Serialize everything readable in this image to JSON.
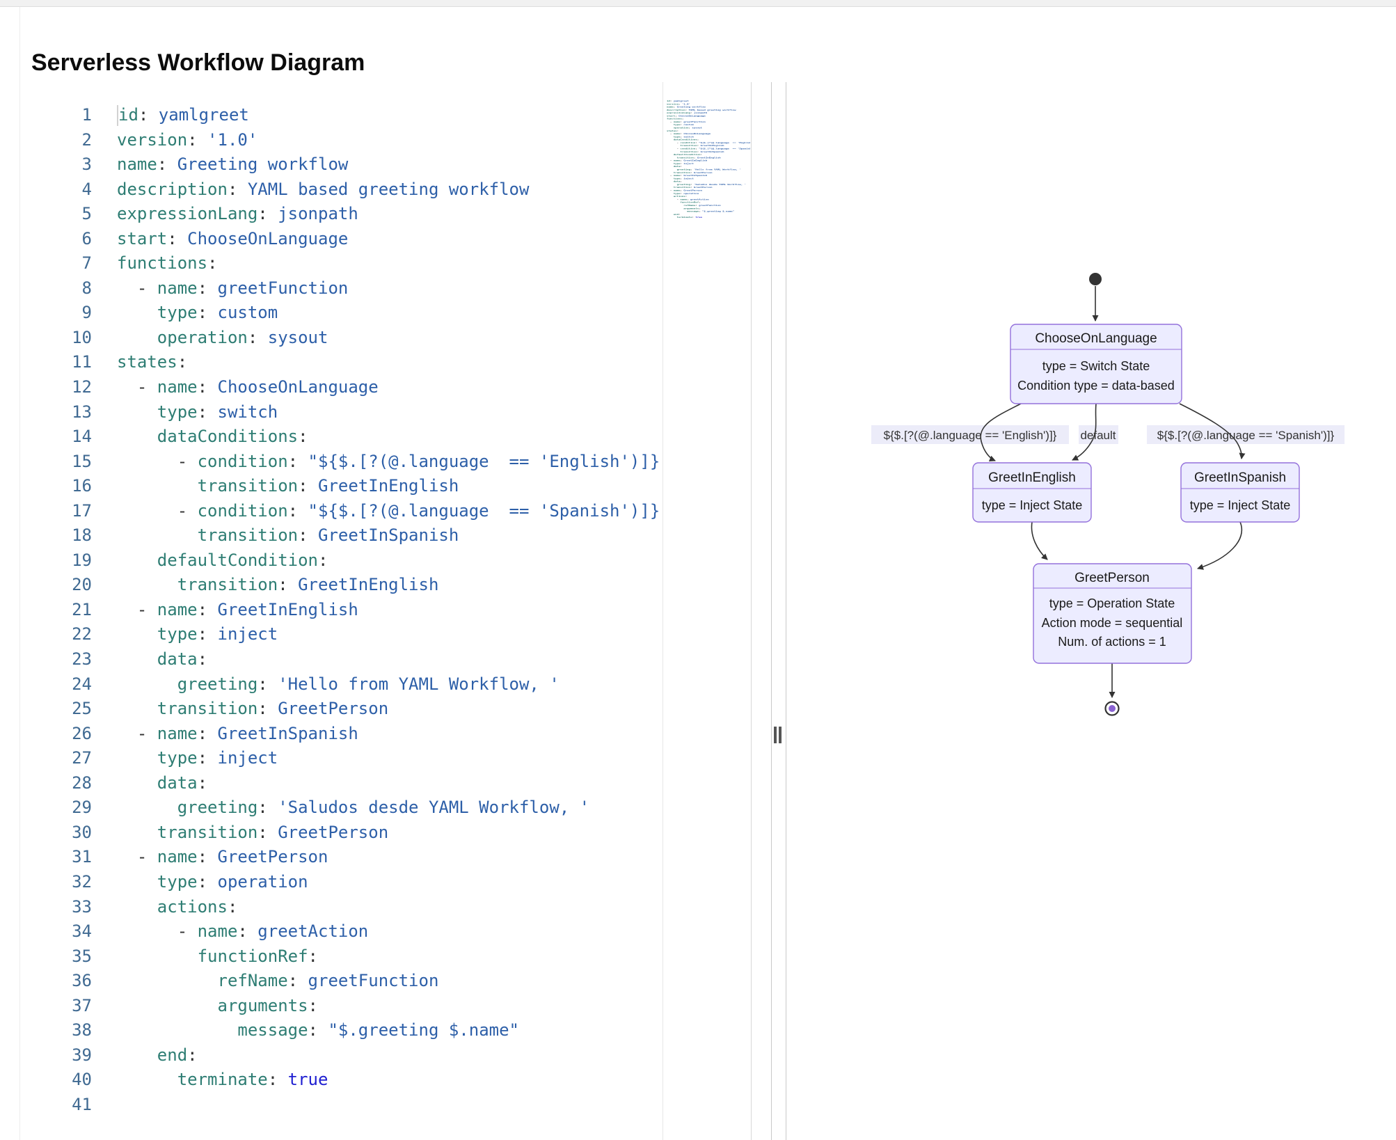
{
  "page": {
    "title": "Serverless Workflow Diagram"
  },
  "editor": {
    "colors": {
      "key": "#2e7d73",
      "value": "#2d5fa8",
      "punctuation": "#333333",
      "boolean": "#1f1fd1",
      "line_number": "#406a92"
    },
    "lines": [
      {
        "n": 1,
        "g": 0,
        "active": true,
        "t": [
          [
            "k",
            "id"
          ],
          [
            "p",
            ":"
          ],
          [
            "v",
            " yamlgreet"
          ]
        ]
      },
      {
        "n": 2,
        "g": 0,
        "t": [
          [
            "k",
            "version"
          ],
          [
            "p",
            ":"
          ],
          [
            "v",
            " '1.0'"
          ]
        ]
      },
      {
        "n": 3,
        "g": 0,
        "t": [
          [
            "k",
            "name"
          ],
          [
            "p",
            ":"
          ],
          [
            "v",
            " Greeting workflow"
          ]
        ]
      },
      {
        "n": 4,
        "g": 0,
        "t": [
          [
            "k",
            "description"
          ],
          [
            "p",
            ":"
          ],
          [
            "v",
            " YAML based greeting workflow"
          ]
        ]
      },
      {
        "n": 5,
        "g": 0,
        "t": [
          [
            "k",
            "expressionLang"
          ],
          [
            "p",
            ":"
          ],
          [
            "v",
            " jsonpath"
          ]
        ]
      },
      {
        "n": 6,
        "g": 0,
        "t": [
          [
            "k",
            "start"
          ],
          [
            "p",
            ":"
          ],
          [
            "v",
            " ChooseOnLanguage"
          ]
        ]
      },
      {
        "n": 7,
        "g": 0,
        "t": [
          [
            "k",
            "functions"
          ],
          [
            "p",
            ":"
          ]
        ]
      },
      {
        "n": 8,
        "g": 1,
        "t": [
          [
            "p",
            "  - "
          ],
          [
            "k",
            "name"
          ],
          [
            "p",
            ":"
          ],
          [
            "v",
            " greetFunction"
          ]
        ]
      },
      {
        "n": 9,
        "g": 2,
        "t": [
          [
            "p",
            "    "
          ],
          [
            "k",
            "type"
          ],
          [
            "p",
            ":"
          ],
          [
            "v",
            " custom"
          ]
        ]
      },
      {
        "n": 10,
        "g": 2,
        "t": [
          [
            "p",
            "    "
          ],
          [
            "k",
            "operation"
          ],
          [
            "p",
            ":"
          ],
          [
            "v",
            " sysout"
          ]
        ]
      },
      {
        "n": 11,
        "g": 0,
        "t": [
          [
            "k",
            "states"
          ],
          [
            "p",
            ":"
          ]
        ]
      },
      {
        "n": 12,
        "g": 1,
        "t": [
          [
            "p",
            "  - "
          ],
          [
            "k",
            "name"
          ],
          [
            "p",
            ":"
          ],
          [
            "v",
            " ChooseOnLanguage"
          ]
        ]
      },
      {
        "n": 13,
        "g": 2,
        "t": [
          [
            "p",
            "    "
          ],
          [
            "k",
            "type"
          ],
          [
            "p",
            ":"
          ],
          [
            "v",
            " switch"
          ]
        ]
      },
      {
        "n": 14,
        "g": 2,
        "t": [
          [
            "p",
            "    "
          ],
          [
            "k",
            "dataConditions"
          ],
          [
            "p",
            ":"
          ]
        ]
      },
      {
        "n": 15,
        "g": 3,
        "t": [
          [
            "p",
            "      - "
          ],
          [
            "k",
            "condition"
          ],
          [
            "p",
            ":"
          ],
          [
            "v",
            " \"${$.[?(@.language  == 'English')]}\""
          ]
        ]
      },
      {
        "n": 16,
        "g": 4,
        "t": [
          [
            "p",
            "        "
          ],
          [
            "k",
            "transition"
          ],
          [
            "p",
            ":"
          ],
          [
            "v",
            " GreetInEnglish"
          ]
        ]
      },
      {
        "n": 17,
        "g": 3,
        "t": [
          [
            "p",
            "      - "
          ],
          [
            "k",
            "condition"
          ],
          [
            "p",
            ":"
          ],
          [
            "v",
            " \"${$.[?(@.language  == 'Spanish')]}\""
          ]
        ]
      },
      {
        "n": 18,
        "g": 4,
        "t": [
          [
            "p",
            "        "
          ],
          [
            "k",
            "transition"
          ],
          [
            "p",
            ":"
          ],
          [
            "v",
            " GreetInSpanish"
          ]
        ]
      },
      {
        "n": 19,
        "g": 2,
        "t": [
          [
            "p",
            "    "
          ],
          [
            "k",
            "defaultCondition"
          ],
          [
            "p",
            ":"
          ]
        ]
      },
      {
        "n": 20,
        "g": 3,
        "t": [
          [
            "p",
            "      "
          ],
          [
            "k",
            "transition"
          ],
          [
            "p",
            ":"
          ],
          [
            "v",
            " GreetInEnglish"
          ]
        ]
      },
      {
        "n": 21,
        "g": 1,
        "t": [
          [
            "p",
            "  - "
          ],
          [
            "k",
            "name"
          ],
          [
            "p",
            ":"
          ],
          [
            "v",
            " GreetInEnglish"
          ]
        ]
      },
      {
        "n": 22,
        "g": 2,
        "t": [
          [
            "p",
            "    "
          ],
          [
            "k",
            "type"
          ],
          [
            "p",
            ":"
          ],
          [
            "v",
            " inject"
          ]
        ]
      },
      {
        "n": 23,
        "g": 2,
        "t": [
          [
            "p",
            "    "
          ],
          [
            "k",
            "data"
          ],
          [
            "p",
            ":"
          ]
        ]
      },
      {
        "n": 24,
        "g": 3,
        "t": [
          [
            "p",
            "      "
          ],
          [
            "k",
            "greeting"
          ],
          [
            "p",
            ":"
          ],
          [
            "v",
            " 'Hello from YAML Workflow, '"
          ]
        ]
      },
      {
        "n": 25,
        "g": 2,
        "t": [
          [
            "p",
            "    "
          ],
          [
            "k",
            "transition"
          ],
          [
            "p",
            ":"
          ],
          [
            "v",
            " GreetPerson"
          ]
        ]
      },
      {
        "n": 26,
        "g": 1,
        "t": [
          [
            "p",
            "  - "
          ],
          [
            "k",
            "name"
          ],
          [
            "p",
            ":"
          ],
          [
            "v",
            " GreetInSpanish"
          ]
        ]
      },
      {
        "n": 27,
        "g": 2,
        "t": [
          [
            "p",
            "    "
          ],
          [
            "k",
            "type"
          ],
          [
            "p",
            ":"
          ],
          [
            "v",
            " inject"
          ]
        ]
      },
      {
        "n": 28,
        "g": 2,
        "t": [
          [
            "p",
            "    "
          ],
          [
            "k",
            "data"
          ],
          [
            "p",
            ":"
          ]
        ]
      },
      {
        "n": 29,
        "g": 3,
        "t": [
          [
            "p",
            "      "
          ],
          [
            "k",
            "greeting"
          ],
          [
            "p",
            ":"
          ],
          [
            "v",
            " 'Saludos desde YAML Workflow, '"
          ]
        ]
      },
      {
        "n": 30,
        "g": 2,
        "t": [
          [
            "p",
            "    "
          ],
          [
            "k",
            "transition"
          ],
          [
            "p",
            ":"
          ],
          [
            "v",
            " GreetPerson"
          ]
        ]
      },
      {
        "n": 31,
        "g": 1,
        "t": [
          [
            "p",
            "  - "
          ],
          [
            "k",
            "name"
          ],
          [
            "p",
            ":"
          ],
          [
            "v",
            " GreetPerson"
          ]
        ]
      },
      {
        "n": 32,
        "g": 2,
        "t": [
          [
            "p",
            "    "
          ],
          [
            "k",
            "type"
          ],
          [
            "p",
            ":"
          ],
          [
            "v",
            " operation"
          ]
        ]
      },
      {
        "n": 33,
        "g": 2,
        "t": [
          [
            "p",
            "    "
          ],
          [
            "k",
            "actions"
          ],
          [
            "p",
            ":"
          ]
        ]
      },
      {
        "n": 34,
        "g": 3,
        "t": [
          [
            "p",
            "      - "
          ],
          [
            "k",
            "name"
          ],
          [
            "p",
            ":"
          ],
          [
            "v",
            " greetAction"
          ]
        ]
      },
      {
        "n": 35,
        "g": 4,
        "t": [
          [
            "p",
            "        "
          ],
          [
            "k",
            "functionRef"
          ],
          [
            "p",
            ":"
          ]
        ]
      },
      {
        "n": 36,
        "g": 5,
        "t": [
          [
            "p",
            "          "
          ],
          [
            "k",
            "refName"
          ],
          [
            "p",
            ":"
          ],
          [
            "v",
            " greetFunction"
          ]
        ]
      },
      {
        "n": 37,
        "g": 5,
        "t": [
          [
            "p",
            "          "
          ],
          [
            "k",
            "arguments"
          ],
          [
            "p",
            ":"
          ]
        ]
      },
      {
        "n": 38,
        "g": 6,
        "t": [
          [
            "p",
            "            "
          ],
          [
            "k",
            "message"
          ],
          [
            "p",
            ":"
          ],
          [
            "v",
            " \"$.greeting $.name\""
          ]
        ]
      },
      {
        "n": 39,
        "g": 2,
        "t": [
          [
            "p",
            "    "
          ],
          [
            "k",
            "end"
          ],
          [
            "p",
            ":"
          ]
        ]
      },
      {
        "n": 40,
        "g": 3,
        "t": [
          [
            "p",
            "      "
          ],
          [
            "k",
            "terminate"
          ],
          [
            "p",
            ":"
          ],
          [
            "a",
            " true"
          ]
        ]
      },
      {
        "n": 41,
        "g": 0,
        "t": []
      }
    ]
  },
  "diagram": {
    "nodes": {
      "choose": {
        "title": "ChooseOnLanguage",
        "line1": "type = Switch State",
        "line2": "Condition type = data-based"
      },
      "english": {
        "title": "GreetInEnglish",
        "line1": "type = Inject State"
      },
      "spanish": {
        "title": "GreetInSpanish",
        "line1": "type = Inject State"
      },
      "person": {
        "title": "GreetPerson",
        "line1": "type = Operation State",
        "line2": "Action mode = sequential",
        "line3": "Num. of actions = 1"
      }
    },
    "edges": {
      "english_label": "${$.[?(@.language == 'English')]}",
      "default_label": "default",
      "spanish_label": "${$.[?(@.language == 'Spanish')]}"
    },
    "colors": {
      "node_fill": "#ececff",
      "node_border": "#9370db",
      "edge": "#333333",
      "label_bg": "#ececf9",
      "end_inner": "#8a63d2",
      "start_fill": "#333333"
    }
  }
}
